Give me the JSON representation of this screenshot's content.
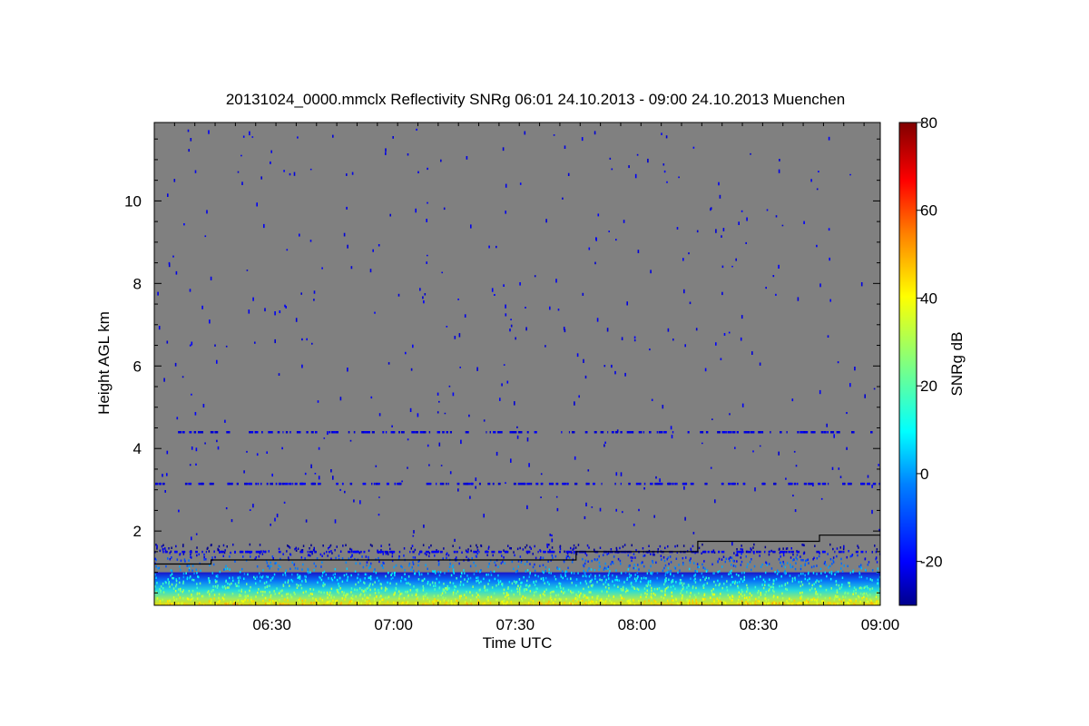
{
  "chart_data": {
    "type": "heatmap",
    "title": "20131024_0000.mmclx Reflectivity SNRg   06:01 24.10.2013 - 09:00 24.10.2013 Muenchen",
    "xlabel": "Time UTC",
    "ylabel": "Height AGL km",
    "colorbar_label": "SNRg dB",
    "xlim": [
      "06:01",
      "09:00"
    ],
    "ylim": [
      0.2,
      11.9
    ],
    "x_ticks": [
      "06:30",
      "07:00",
      "07:30",
      "08:00",
      "08:30",
      "09:00"
    ],
    "y_ticks": [
      2,
      4,
      6,
      8,
      10
    ],
    "colorbar_range": [
      -30,
      80
    ],
    "colorbar_ticks": [
      -20,
      0,
      20,
      40,
      60,
      80
    ],
    "background_color": "#808080",
    "colormap": [
      "#00008c",
      "#0000ff",
      "#0080ff",
      "#00ffff",
      "#80ff80",
      "#ffff00",
      "#ff8000",
      "#ff0000",
      "#800000"
    ],
    "boundary_line": {
      "name": "",
      "points": [
        [
          "06:01",
          1.2
        ],
        [
          "06:15",
          1.2
        ],
        [
          "06:15",
          1.3
        ],
        [
          "07:45",
          1.3
        ],
        [
          "07:45",
          1.5
        ],
        [
          "08:15",
          1.5
        ],
        [
          "08:15",
          1.75
        ],
        [
          "08:45",
          1.75
        ],
        [
          "08:45",
          1.9
        ],
        [
          "09:00",
          1.9
        ]
      ]
    },
    "echo_layers": [
      {
        "height": 4.4,
        "snr": -20
      },
      {
        "height": 3.15,
        "snr": -20
      },
      {
        "height": 1.5,
        "snr": -18
      }
    ],
    "surface_layer": {
      "top": 1.0,
      "snr_max": 45
    }
  }
}
